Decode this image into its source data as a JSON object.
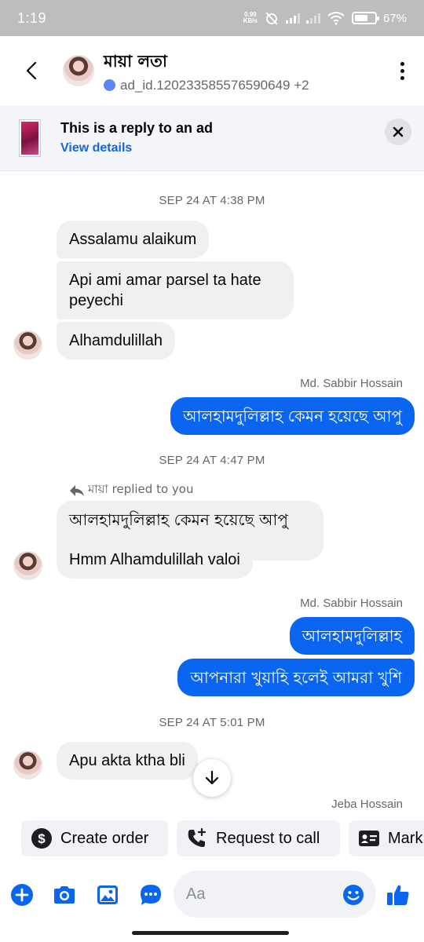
{
  "status_bar": {
    "time": "1:19",
    "net_speed_value": "0.99",
    "net_speed_unit": "KB/s",
    "battery_percent": "67%",
    "battery_level": 0.67
  },
  "header": {
    "contact_name": "মায়া লতা",
    "contact_subtitle": "ad_id.120233585576590649 +2"
  },
  "ad_banner": {
    "title": "This is a reply to an ad",
    "link_label": "View details"
  },
  "messages": {
    "ts1": "SEP 24 AT 4:38 PM",
    "in1": "Assalamu alaikum",
    "in2_line1": "Api ami amar parsel ta hate",
    "in2_line2": "peyechi",
    "in3": "Alhamdulillah",
    "sender1": "Md. Sabbir Hossain",
    "out1": "আলহামদুলিল্লাহ কেমন হয়েছে আপু",
    "ts2": "SEP 24 AT 4:47 PM",
    "reply_label": "মায়া replied to you",
    "quoted": "আলহামদুলিল্লাহ কেমন হয়েছে আপু",
    "in4": "Hmm Alhamdulillah valoi",
    "sender2": "Md. Sabbir Hossain",
    "out2": "আলহামদুলিল্লাহ",
    "out3": "আপনারা খুয়াহি হলেই আমরা খুশি",
    "ts3": "SEP 24 AT 5:01 PM",
    "in5": "Apu akta ktha bli",
    "sender3": "Jeba Hossain"
  },
  "quick_actions": {
    "create_order": "Create order",
    "request_call": "Request to call",
    "mark": "Mark"
  },
  "composer": {
    "placeholder": "Aa"
  },
  "colors": {
    "accent": "#0a66f0",
    "incoming_bubble": "#f0f0f0",
    "status_bar": "#bdbdbd"
  }
}
